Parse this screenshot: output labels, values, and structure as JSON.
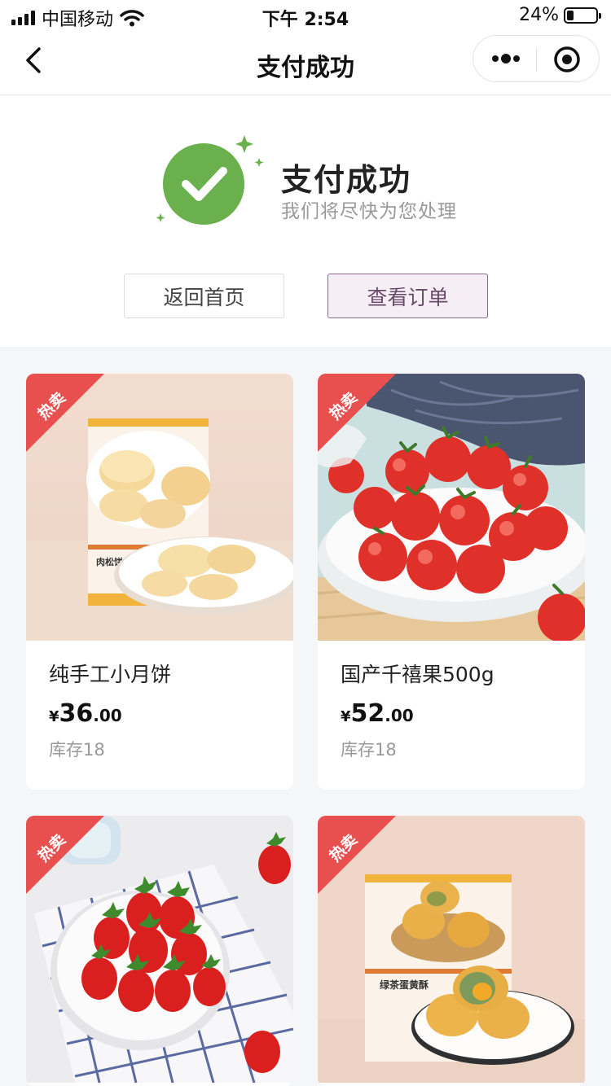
{
  "status_bar": {
    "carrier": "中国移动",
    "time": "下午 2:54",
    "battery": "24%",
    "battery_level": 0.24
  },
  "nav": {
    "title": "支付成功"
  },
  "success": {
    "title": "支付成功",
    "subtitle": "我们将尽快为您处理",
    "home_button": "返回首页",
    "order_button": "查看订单",
    "accent_color": "#6ab04c"
  },
  "products": [
    {
      "name": "纯手工小月饼",
      "currency": "¥",
      "price_int": "36",
      "price_dec": ".00",
      "stock": "库存18",
      "badge": "热卖",
      "image": "mooncake-box",
      "box_label": "肉松饼"
    },
    {
      "name": "国产千禧果500g",
      "currency": "¥",
      "price_int": "52",
      "price_dec": ".00",
      "stock": "库存18",
      "badge": "热卖",
      "image": "cherry-tomatoes"
    },
    {
      "name": "",
      "badge": "热卖",
      "image": "strawberries"
    },
    {
      "name": "",
      "badge": "热卖",
      "image": "egg-yolk-pastry-box",
      "box_label": "绿茶蛋黄酥"
    }
  ],
  "colors": {
    "badge_red": "#e8504f",
    "order_button_border": "#8a6a8a"
  }
}
